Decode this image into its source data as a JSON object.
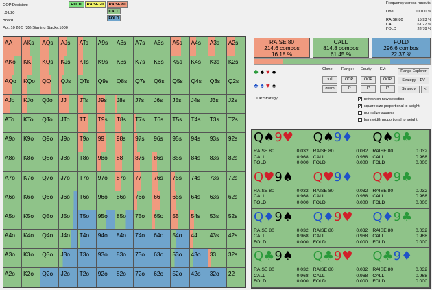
{
  "info": {
    "decision": "OOP Decision:",
    "line": "r:0:b20",
    "board": "Board",
    "pot": "Pot: 10 20 5 (35) Starting Stacks:1000"
  },
  "nav": [
    {
      "label": "ROOT",
      "bg": "#7de07d"
    },
    {
      "label": "RAISE 20",
      "bg": "#f5f56a"
    },
    {
      "label": "RAISE 80",
      "bg": "#f09a7f"
    },
    {
      "label": "CALL",
      "bg": "#8fc389"
    },
    {
      "label": "FOLD",
      "bg": "#6fa4cc"
    }
  ],
  "freq": {
    "title": "Frequency across runouts:",
    "line_label": "Line:",
    "line_value": "100.00 %",
    "rows": [
      {
        "k": "RAISE 80",
        "v": "15.93 %"
      },
      {
        "k": "CALL",
        "v": "61.27 %"
      },
      {
        "k": "FOLD",
        "v": "22.79 %"
      }
    ]
  },
  "colors": {
    "raise": "#f09a7f",
    "call": "#8fc389",
    "fold": "#6fa4cc",
    "red": "#d0202a",
    "blue": "#1f52c8",
    "green": "#2a9a3a"
  },
  "actions": [
    {
      "name": "RAISE 80",
      "combos": "214.6 combos",
      "pct": "16.18 %",
      "bg": "#f09a7f"
    },
    {
      "name": "CALL",
      "combos": "814.8 combos",
      "pct": "61.45 %",
      "bg": "#8fc389"
    },
    {
      "name": "FOLD",
      "combos": "296.6 combos",
      "pct": "22.37 %",
      "bg": "#6fa4cc"
    }
  ],
  "strategy_bar": [
    0.16,
    0.615,
    0.225
  ],
  "suits_top": [
    "♣",
    "♠",
    "♥",
    "♠"
  ],
  "suits_bottom": [
    "♣",
    "♠",
    "♥",
    "♠"
  ],
  "controls": {
    "clone": "Clone:",
    "range": "Range:",
    "equity": "Equity:",
    "ev": "EV:",
    "full": "full",
    "zoom": "zoom",
    "oop1": "OOP",
    "ip1": "IP",
    "oop2": "OOP",
    "ip2": "IP",
    "oop3": "OOP",
    "ip3": "IP",
    "range_explorer": "Range Explorer",
    "strategy_ev": "Strategy + EV",
    "strategy": "Strategy",
    "lt": "<",
    "oop_strategy": "OOP Strategy"
  },
  "options": [
    {
      "label": "refresh on new selection",
      "checked": true
    },
    {
      "label": "square size proportional to weight",
      "checked": true
    },
    {
      "label": "normalize squares",
      "checked": false
    },
    {
      "label": "bars width proportional to weight",
      "checked": false
    }
  ],
  "grid": [
    [
      [
        "AA",
        1,
        0
      ],
      [
        "AKs",
        0.45,
        0
      ],
      [
        "AQs",
        0.48,
        0
      ],
      [
        "AJs",
        0.42,
        0
      ],
      [
        "ATs",
        0.3,
        0
      ],
      [
        "A9s",
        0,
        0
      ],
      [
        "A8s",
        0,
        0
      ],
      [
        "A7s",
        0,
        0
      ],
      [
        "A6s",
        0,
        0
      ],
      [
        "A5s",
        0.55,
        0
      ],
      [
        "A4s",
        0.35,
        0
      ],
      [
        "A3s",
        0.4,
        0
      ],
      [
        "A2s",
        0.45,
        0
      ]
    ],
    [
      [
        "AKo",
        0.62,
        0
      ],
      [
        "KK",
        0.55,
        0
      ],
      [
        "KQs",
        0.5,
        0
      ],
      [
        "KJs",
        0.3,
        0
      ],
      [
        "KTs",
        0.3,
        0
      ],
      [
        "K9s",
        0,
        0
      ],
      [
        "K8s",
        0,
        0
      ],
      [
        "K7s",
        0,
        0
      ],
      [
        "K6s",
        0,
        0
      ],
      [
        "K5s",
        0,
        0
      ],
      [
        "K4s",
        0,
        0
      ],
      [
        "K3s",
        0,
        0
      ],
      [
        "K2s",
        0,
        0
      ]
    ],
    [
      [
        "AQo",
        0.5,
        0
      ],
      [
        "KQo",
        0.3,
        0
      ],
      [
        "QQ",
        0.55,
        0
      ],
      [
        "QJs",
        0.12,
        0
      ],
      [
        "QTs",
        0,
        0
      ],
      [
        "Q9s",
        0,
        0
      ],
      [
        "Q8s",
        0,
        0
      ],
      [
        "Q7s",
        0,
        0
      ],
      [
        "Q6s",
        0,
        0
      ],
      [
        "Q5s",
        0,
        0
      ],
      [
        "Q4s",
        0,
        0
      ],
      [
        "Q3s",
        0,
        0
      ],
      [
        "Q2s",
        0,
        0
      ]
    ],
    [
      [
        "AJo",
        0.35,
        0
      ],
      [
        "KJo",
        0.3,
        0
      ],
      [
        "QJo",
        0,
        0
      ],
      [
        "JJ",
        0.5,
        0
      ],
      [
        "JTs",
        0.3,
        0
      ],
      [
        "J9s",
        0.45,
        0
      ],
      [
        "J8s",
        0.1,
        0
      ],
      [
        "J7s",
        0,
        0
      ],
      [
        "J6s",
        0,
        0
      ],
      [
        "J5s",
        0,
        0
      ],
      [
        "J4s",
        0,
        0
      ],
      [
        "J3s",
        0,
        0
      ],
      [
        "J2s",
        0,
        0
      ]
    ],
    [
      [
        "ATo",
        0,
        0
      ],
      [
        "KTo",
        0,
        0
      ],
      [
        "QTo",
        0,
        0
      ],
      [
        "JTo",
        0,
        0
      ],
      [
        "TT",
        0.55,
        0
      ],
      [
        "T9s",
        0.45,
        0
      ],
      [
        "T8s",
        0.35,
        0
      ],
      [
        "T7s",
        0.1,
        0
      ],
      [
        "T6s",
        0,
        0
      ],
      [
        "T5s",
        0,
        0
      ],
      [
        "T4s",
        0,
        0
      ],
      [
        "T3s",
        0,
        0
      ],
      [
        "T2s",
        0,
        0
      ]
    ],
    [
      [
        "A9o",
        0,
        0
      ],
      [
        "K9o",
        0,
        0
      ],
      [
        "Q9o",
        0,
        0
      ],
      [
        "J9o",
        0,
        0
      ],
      [
        "T9o",
        0.3,
        0
      ],
      [
        "99",
        0.55,
        0
      ],
      [
        "98s",
        0.4,
        0
      ],
      [
        "97s",
        0.2,
        0
      ],
      [
        "96s",
        0,
        0
      ],
      [
        "95s",
        0,
        0
      ],
      [
        "94s",
        0,
        0
      ],
      [
        "93s",
        0,
        0
      ],
      [
        "92s",
        0,
        0
      ]
    ],
    [
      [
        "A8o",
        0,
        0
      ],
      [
        "K8o",
        0,
        0
      ],
      [
        "Q8o",
        0,
        0
      ],
      [
        "J8o",
        0,
        0
      ],
      [
        "T8o",
        0,
        0
      ],
      [
        "98o",
        0.25,
        0
      ],
      [
        "88",
        0.4,
        0
      ],
      [
        "87s",
        0.35,
        0
      ],
      [
        "86s",
        0.25,
        0
      ],
      [
        "85s",
        0,
        0
      ],
      [
        "84s",
        0,
        0
      ],
      [
        "83s",
        0,
        0
      ],
      [
        "82s",
        0,
        0
      ]
    ],
    [
      [
        "A7o",
        0,
        0
      ],
      [
        "K7o",
        0,
        0
      ],
      [
        "Q7o",
        0,
        0
      ],
      [
        "J7o",
        0,
        0
      ],
      [
        "T7o",
        0,
        0
      ],
      [
        "97o",
        0,
        0
      ],
      [
        "87o",
        0.3,
        0
      ],
      [
        "77",
        0.4,
        0
      ],
      [
        "76s",
        0.3,
        0
      ],
      [
        "75s",
        0.2,
        0
      ],
      [
        "74s",
        0,
        0
      ],
      [
        "73s",
        0,
        0
      ],
      [
        "72s",
        0,
        0
      ]
    ],
    [
      [
        "A6o",
        0,
        0
      ],
      [
        "K6o",
        0,
        0
      ],
      [
        "Q6o",
        0,
        0
      ],
      [
        "J6o",
        0,
        0.2
      ],
      [
        "T6o",
        0,
        0
      ],
      [
        "96o",
        0,
        0
      ],
      [
        "86o",
        0,
        0
      ],
      [
        "76o",
        0.2,
        0
      ],
      [
        "66",
        0.4,
        0
      ],
      [
        "65s",
        0.3,
        0
      ],
      [
        "64s",
        0,
        0
      ],
      [
        "63s",
        0,
        0
      ],
      [
        "62s",
        0,
        0
      ]
    ],
    [
      [
        "A5o",
        0,
        0
      ],
      [
        "K5o",
        0,
        0
      ],
      [
        "Q5o",
        0,
        0
      ],
      [
        "J5o",
        0,
        0.25
      ],
      [
        "T5o",
        0,
        1
      ],
      [
        "95o",
        0,
        0.5
      ],
      [
        "85o",
        0,
        0.4
      ],
      [
        "75o",
        0,
        0
      ],
      [
        "65o",
        0.15,
        0
      ],
      [
        "55",
        0.35,
        0
      ],
      [
        "54s",
        0.25,
        0
      ],
      [
        "53s",
        0,
        0
      ],
      [
        "52s",
        0,
        0
      ]
    ],
    [
      [
        "A4o",
        0,
        0
      ],
      [
        "K4o",
        0,
        0
      ],
      [
        "Q4o",
        0,
        0
      ],
      [
        "J4o",
        0,
        0.35
      ],
      [
        "T4o",
        0,
        0.9
      ],
      [
        "94o",
        0,
        1
      ],
      [
        "84o",
        0,
        1
      ],
      [
        "74o",
        0,
        1
      ],
      [
        "64o",
        0,
        1
      ],
      [
        "54o",
        0,
        0.7
      ],
      [
        "44",
        0.2,
        0
      ],
      [
        "43s",
        0,
        0
      ],
      [
        "42s",
        0,
        0
      ]
    ],
    [
      [
        "A3o",
        0,
        0
      ],
      [
        "K3o",
        0,
        0
      ],
      [
        "Q3o",
        0,
        0
      ],
      [
        "J3o",
        0,
        0.8
      ],
      [
        "T3o",
        0,
        1
      ],
      [
        "93o",
        0,
        1
      ],
      [
        "83o",
        0,
        1
      ],
      [
        "73o",
        0,
        1
      ],
      [
        "63o",
        0,
        1
      ],
      [
        "53o",
        0,
        0.8
      ],
      [
        "43o",
        0,
        0.85
      ],
      [
        "33",
        0.15,
        0
      ],
      [
        "32s",
        0,
        0
      ]
    ],
    [
      [
        "A2o",
        0,
        0
      ],
      [
        "K2o",
        0,
        0
      ],
      [
        "Q2o",
        0,
        1
      ],
      [
        "J2o",
        0,
        1
      ],
      [
        "T2o",
        0,
        1
      ],
      [
        "92o",
        0,
        1
      ],
      [
        "82o",
        0,
        1
      ],
      [
        "72o",
        0,
        1
      ],
      [
        "62o",
        0,
        1
      ],
      [
        "52o",
        0,
        1
      ],
      [
        "42o",
        0,
        1
      ],
      [
        "32o",
        0,
        1
      ],
      [
        "22",
        0,
        0
      ]
    ]
  ],
  "combos": [
    {
      "r1": "Q",
      "s1": "♠",
      "c1": "#000000",
      "r2": "9",
      "s2": "♥",
      "c2": "#d0202a",
      "bg": "#8fc389",
      "rows": [
        [
          "RAISE 80",
          "0.032"
        ],
        [
          "CALL",
          "0.968"
        ],
        [
          "FOLD",
          "0.000"
        ]
      ]
    },
    {
      "r1": "Q",
      "s1": "♠",
      "c1": "#000000",
      "r2": "9",
      "s2": "♦",
      "c2": "#1f52c8",
      "bg": "#8fc389",
      "rows": [
        [
          "RAISE 80",
          "0.032"
        ],
        [
          "CALL",
          "0.968"
        ],
        [
          "FOLD",
          "0.000"
        ]
      ]
    },
    {
      "r1": "Q",
      "s1": "♠",
      "c1": "#000000",
      "r2": "9",
      "s2": "♣",
      "c2": "#2a9a3a",
      "bg": "#8fc389",
      "rows": [
        [
          "RAISE 80",
          "0.032"
        ],
        [
          "CALL",
          "0.968"
        ],
        [
          "FOLD",
          "0.000"
        ]
      ]
    },
    {
      "r1": "Q",
      "s1": "♥",
      "c1": "#d0202a",
      "r2": "9",
      "s2": "♠",
      "c2": "#000000",
      "bg": "#8fc389",
      "rows": [
        [
          "RAISE 80",
          "0.032"
        ],
        [
          "CALL",
          "0.968"
        ],
        [
          "FOLD",
          "0.000"
        ]
      ]
    },
    {
      "r1": "Q",
      "s1": "♥",
      "c1": "#d0202a",
      "r2": "9",
      "s2": "♦",
      "c2": "#1f52c8",
      "bg": "#8fc389",
      "rows": [
        [
          "RAISE 80",
          "0.032"
        ],
        [
          "CALL",
          "0.968"
        ],
        [
          "FOLD",
          "0.000"
        ]
      ]
    },
    {
      "r1": "Q",
      "s1": "♥",
      "c1": "#d0202a",
      "r2": "9",
      "s2": "♣",
      "c2": "#2a9a3a",
      "bg": "#8fc389",
      "rows": [
        [
          "RAISE 80",
          "0.032"
        ],
        [
          "CALL",
          "0.968"
        ],
        [
          "FOLD",
          "0.000"
        ]
      ]
    },
    {
      "r1": "Q",
      "s1": "♦",
      "c1": "#1f52c8",
      "r2": "9",
      "s2": "♠",
      "c2": "#000000",
      "bg": "#8fc389",
      "rows": [
        [
          "RAISE 80",
          "0.032"
        ],
        [
          "CALL",
          "0.968"
        ],
        [
          "FOLD",
          "0.000"
        ]
      ]
    },
    {
      "r1": "Q",
      "s1": "♦",
      "c1": "#1f52c8",
      "r2": "9",
      "s2": "♥",
      "c2": "#d0202a",
      "bg": "#8fc389",
      "rows": [
        [
          "RAISE 80",
          "0.032"
        ],
        [
          "CALL",
          "0.968"
        ],
        [
          "FOLD",
          "0.000"
        ]
      ]
    },
    {
      "r1": "Q",
      "s1": "♦",
      "c1": "#1f52c8",
      "r2": "9",
      "s2": "♣",
      "c2": "#2a9a3a",
      "bg": "#8fc389",
      "rows": [
        [
          "RAISE 80",
          "0.032"
        ],
        [
          "CALL",
          "0.968"
        ],
        [
          "FOLD",
          "0.000"
        ]
      ]
    },
    {
      "r1": "Q",
      "s1": "♣",
      "c1": "#2a9a3a",
      "r2": "9",
      "s2": "♠",
      "c2": "#000000",
      "bg": "#8fc389",
      "rows": [
        [
          "RAISE 80",
          "0.032"
        ],
        [
          "CALL",
          "0.968"
        ],
        [
          "FOLD",
          "0.000"
        ]
      ]
    },
    {
      "r1": "Q",
      "s1": "♣",
      "c1": "#2a9a3a",
      "r2": "9",
      "s2": "♥",
      "c2": "#d0202a",
      "bg": "#8fc389",
      "rows": [
        [
          "RAISE 80",
          "0.032"
        ],
        [
          "CALL",
          "0.968"
        ],
        [
          "FOLD",
          "0.000"
        ]
      ]
    },
    {
      "r1": "Q",
      "s1": "♣",
      "c1": "#2a9a3a",
      "r2": "9",
      "s2": "♦",
      "c2": "#1f52c8",
      "bg": "#8fc389",
      "rows": [
        [
          "RAISE 80",
          "0.032"
        ],
        [
          "CALL",
          "0.968"
        ],
        [
          "FOLD",
          "0.000"
        ]
      ]
    }
  ]
}
